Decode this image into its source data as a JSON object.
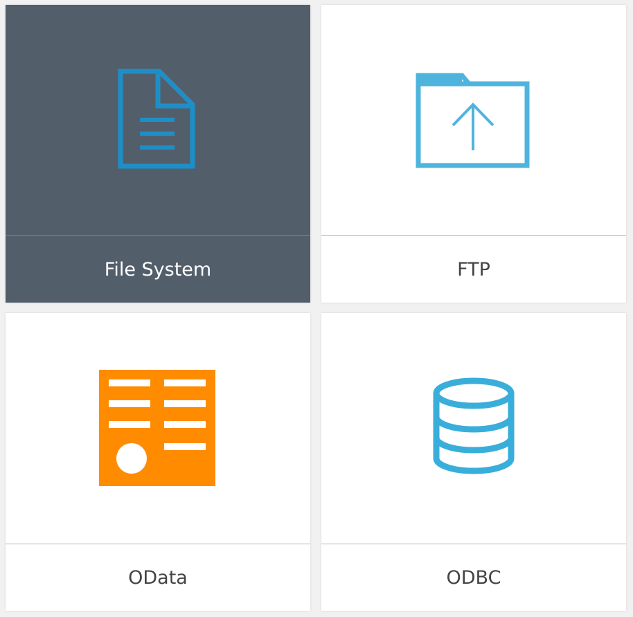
{
  "tiles": [
    {
      "label": "File System",
      "icon": "document-icon",
      "selected": true
    },
    {
      "label": "FTP",
      "icon": "folder-upload-icon",
      "selected": false
    },
    {
      "label": "OData",
      "icon": "odata-icon",
      "selected": false
    },
    {
      "label": "ODBC",
      "icon": "database-icon",
      "selected": false
    }
  ],
  "colors": {
    "selected_bg": "#535e6b",
    "file_icon": "#1e8fc6",
    "ftp_icon": "#4fb4dd",
    "odata_icon": "#ff8c00",
    "odbc_icon": "#3aaedb"
  }
}
